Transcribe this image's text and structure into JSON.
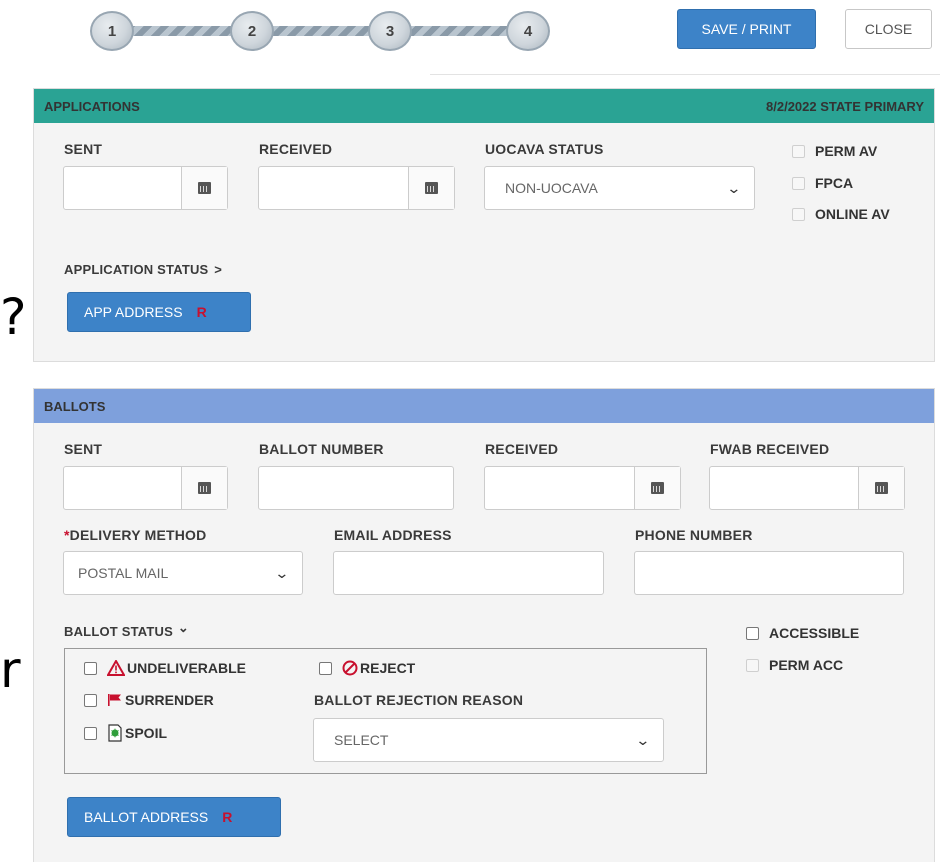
{
  "stepper": {
    "steps": [
      "1",
      "2",
      "3",
      "4"
    ]
  },
  "toolbar": {
    "save_label": "SAVE / PRINT",
    "close_label": "CLOSE"
  },
  "stray_glyphs": {
    "question": "?",
    "letter": "r"
  },
  "applications": {
    "title": "APPLICATIONS",
    "election": "8/2/2022 STATE PRIMARY",
    "sent_label": "SENT",
    "received_label": "RECEIVED",
    "uocava_label": "UOCAVA STATUS",
    "uocava_value": "NON-UOCAVA",
    "perm_av": "PERM AV",
    "fpca": "FPCA",
    "online_av": "ONLINE AV",
    "app_status_label": "APPLICATION STATUS",
    "app_status_chevron": ">",
    "app_address_label": "APP ADDRESS",
    "app_address_flag": "R"
  },
  "ballots": {
    "title": "BALLOTS",
    "sent_label": "SENT",
    "ballot_number_label": "BALLOT NUMBER",
    "received_label": "RECEIVED",
    "fwab_label": "FWAB RECEIVED",
    "delivery_required": "*",
    "delivery_label": "DELIVERY METHOD",
    "delivery_value": "POSTAL MAIL",
    "email_label": "EMAIL ADDRESS",
    "phone_label": "PHONE NUMBER",
    "status_label": "BALLOT STATUS",
    "status_chevron": "⌄",
    "accessible": "ACCESSIBLE",
    "perm_acc": "PERM ACC",
    "undeliverable": "UNDELIVERABLE",
    "reject": "REJECT",
    "surrender": "SURRENDER",
    "spoil": "SPOIL",
    "rejection_reason_label": "BALLOT REJECTION REASON",
    "rejection_reason_value": "SELECT",
    "ballot_address_label": "BALLOT ADDRESS",
    "ballot_address_flag": "R"
  },
  "colors": {
    "applications_header": "#2aa394",
    "ballots_header": "#7ea0dc",
    "primary_button": "#3d83c8",
    "flag_red": "#c8102e"
  }
}
